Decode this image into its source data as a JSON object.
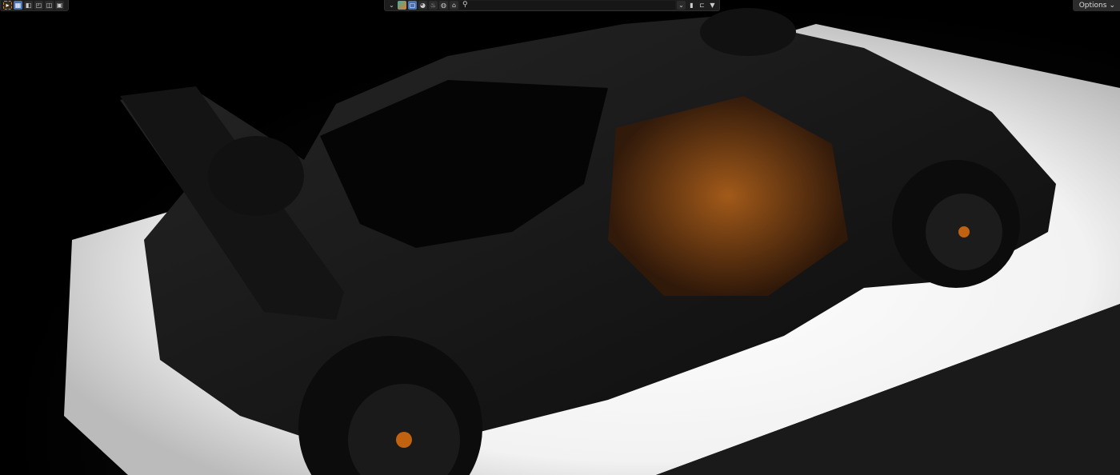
{
  "left_toolbar": {
    "icons": [
      "select-box-icon",
      "mode-new-icon",
      "mode-extend-icon",
      "mode-subtract-icon",
      "mode-difference-icon",
      "mode-intersect-icon"
    ]
  },
  "center_header": {
    "icons": [
      "dropdown-chevron-icon",
      "collection-icon",
      "object-icon",
      "material-icon",
      "particles-icon",
      "world-icon",
      "paint-icon",
      "search-icon"
    ],
    "search_value": "",
    "right_icons": [
      "toggle-chevron-icon",
      "bookmark-icon",
      "hierarchy-icon",
      "filter-icon"
    ]
  },
  "options": {
    "label": "Options",
    "chevron": "⌄"
  },
  "colors": {
    "accent": "#4772b3",
    "select": "#e87d0d",
    "interior": "#c0620f"
  }
}
